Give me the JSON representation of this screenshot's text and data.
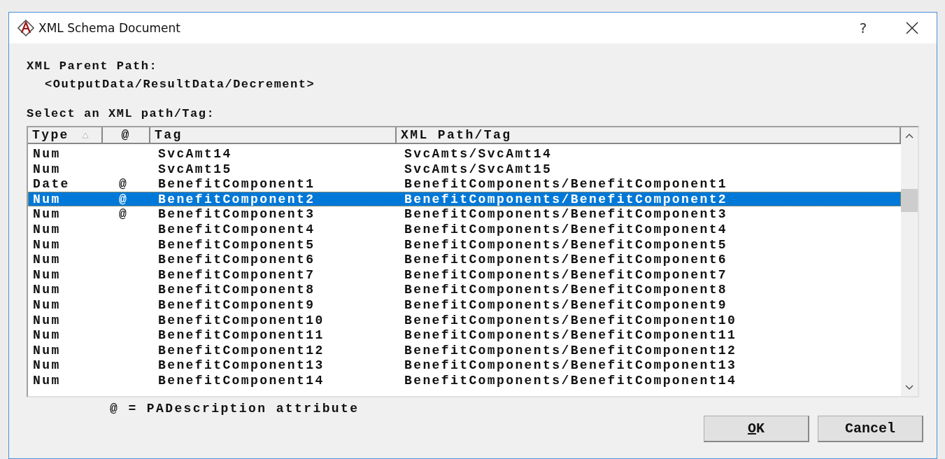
{
  "window": {
    "title": "XML Schema Document",
    "help": "?"
  },
  "parent_path": {
    "label": "XML Parent Path:",
    "value": "<OutputData/ResultData/Decrement>"
  },
  "select_label": "Select an XML path/Tag:",
  "table": {
    "columns": [
      {
        "label": "Type",
        "sorted": true
      },
      {
        "label": "@",
        "sorted": false
      },
      {
        "label": "Tag",
        "sorted": false
      },
      {
        "label": "XML Path/Tag",
        "sorted": false
      }
    ],
    "rows": [
      {
        "type": "Num",
        "attr": "",
        "tag": "SvcAmt14",
        "path": "SvcAmts/SvcAmt14",
        "selected": false
      },
      {
        "type": "Num",
        "attr": "",
        "tag": "SvcAmt15",
        "path": "SvcAmts/SvcAmt15",
        "selected": false
      },
      {
        "type": "Date",
        "attr": "@",
        "tag": "BenefitComponent1",
        "path": "BenefitComponents/BenefitComponent1",
        "selected": false
      },
      {
        "type": "Num",
        "attr": "@",
        "tag": "BenefitComponent2",
        "path": "BenefitComponents/BenefitComponent2",
        "selected": true
      },
      {
        "type": "Num",
        "attr": "@",
        "tag": "BenefitComponent3",
        "path": "BenefitComponents/BenefitComponent3",
        "selected": false
      },
      {
        "type": "Num",
        "attr": "",
        "tag": "BenefitComponent4",
        "path": "BenefitComponents/BenefitComponent4",
        "selected": false
      },
      {
        "type": "Num",
        "attr": "",
        "tag": "BenefitComponent5",
        "path": "BenefitComponents/BenefitComponent5",
        "selected": false
      },
      {
        "type": "Num",
        "attr": "",
        "tag": "BenefitComponent6",
        "path": "BenefitComponents/BenefitComponent6",
        "selected": false
      },
      {
        "type": "Num",
        "attr": "",
        "tag": "BenefitComponent7",
        "path": "BenefitComponents/BenefitComponent7",
        "selected": false
      },
      {
        "type": "Num",
        "attr": "",
        "tag": "BenefitComponent8",
        "path": "BenefitComponents/BenefitComponent8",
        "selected": false
      },
      {
        "type": "Num",
        "attr": "",
        "tag": "BenefitComponent9",
        "path": "BenefitComponents/BenefitComponent9",
        "selected": false
      },
      {
        "type": "Num",
        "attr": "",
        "tag": "BenefitComponent10",
        "path": "BenefitComponents/BenefitComponent10",
        "selected": false
      },
      {
        "type": "Num",
        "attr": "",
        "tag": "BenefitComponent11",
        "path": "BenefitComponents/BenefitComponent11",
        "selected": false
      },
      {
        "type": "Num",
        "attr": "",
        "tag": "BenefitComponent12",
        "path": "BenefitComponents/BenefitComponent12",
        "selected": false
      },
      {
        "type": "Num",
        "attr": "",
        "tag": "BenefitComponent13",
        "path": "BenefitComponents/BenefitComponent13",
        "selected": false
      },
      {
        "type": "Num",
        "attr": "",
        "tag": "BenefitComponent14",
        "path": "BenefitComponents/BenefitComponent14",
        "selected": false
      }
    ]
  },
  "legend": "@ = PADescription attribute",
  "buttons": [
    {
      "label": "OK",
      "mnemonic": true
    },
    {
      "label": "Cancel",
      "mnemonic": false
    }
  ]
}
